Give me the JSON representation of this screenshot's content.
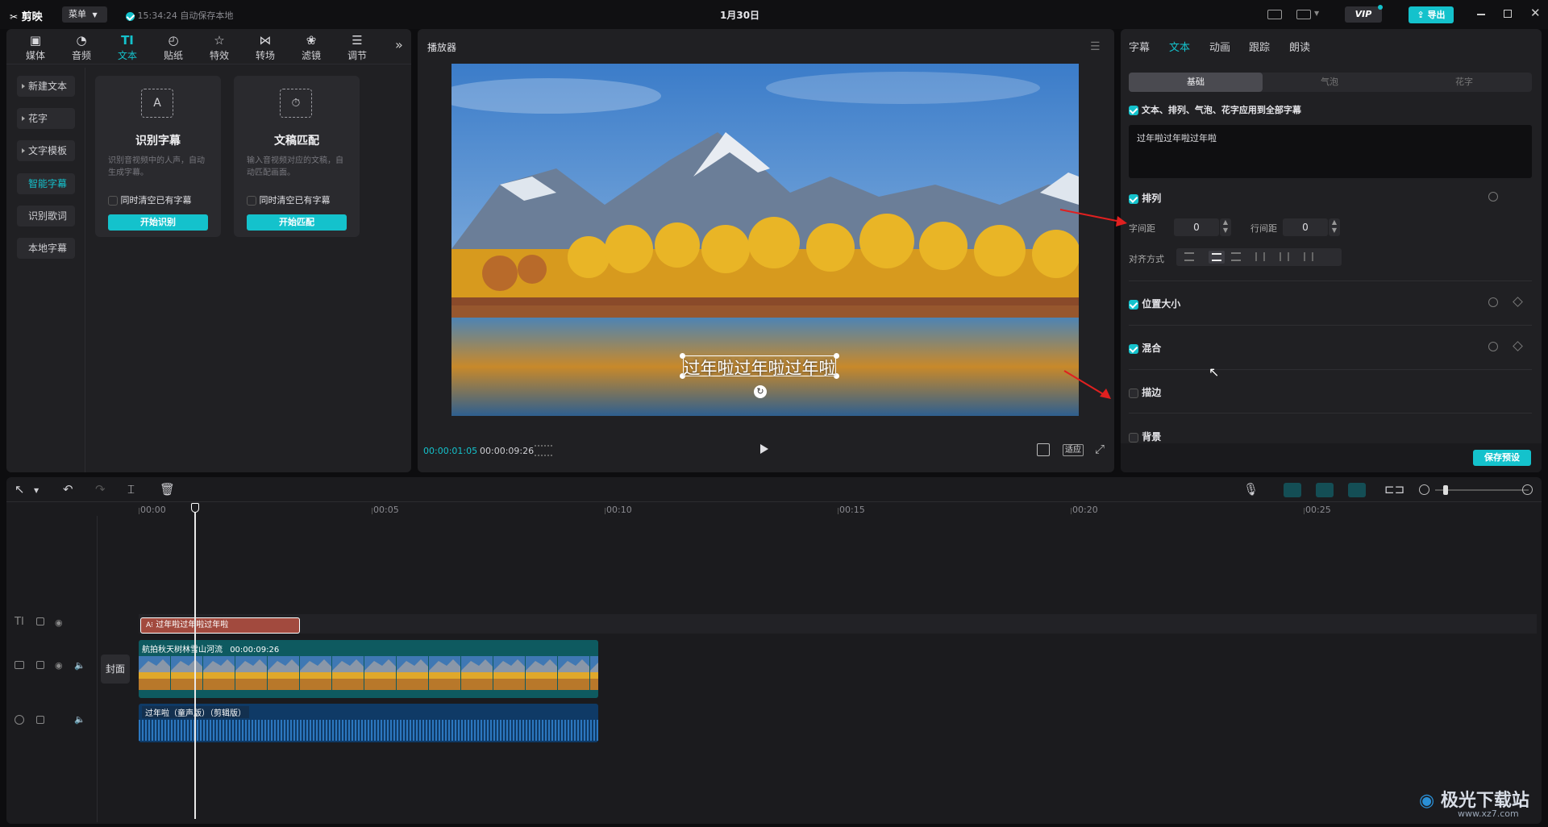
{
  "app": {
    "logo": "剪映",
    "menu_label": "菜单",
    "autosave": "15:34:24 自动保存本地",
    "project_title": "1月30日",
    "vip_label": "VIP",
    "export_label": "导出"
  },
  "toolbar_tabs": [
    {
      "label": "媒体",
      "icon": "media-icon"
    },
    {
      "label": "音频",
      "icon": "audio-icon"
    },
    {
      "label": "文本",
      "icon": "text-icon"
    },
    {
      "label": "贴纸",
      "icon": "sticker-icon"
    },
    {
      "label": "特效",
      "icon": "effects-icon"
    },
    {
      "label": "转场",
      "icon": "transition-icon"
    },
    {
      "label": "滤镜",
      "icon": "filter-icon"
    },
    {
      "label": "调节",
      "icon": "adjust-icon"
    }
  ],
  "text_sidebar": [
    "新建文本",
    "花字",
    "文字模板",
    "智能字幕",
    "识别歌词",
    "本地字幕"
  ],
  "cards": [
    {
      "title": "识别字幕",
      "desc": "识别音视频中的人声，自动生成字幕。",
      "option": "同时清空已有字幕",
      "button": "开始识别"
    },
    {
      "title": "文稿匹配",
      "desc": "输入音视频对应的文稿，自动匹配画面。",
      "option": "同时清空已有字幕",
      "button": "开始匹配"
    }
  ],
  "player": {
    "title": "播放器",
    "subtitle_text": "过年啦过年啦过年啦",
    "current_time": "00:00:01:05",
    "total_time": "00:00:09:26",
    "fit_label": "适应"
  },
  "inspector": {
    "tabs": [
      "字幕",
      "文本",
      "动画",
      "跟踪",
      "朗读"
    ],
    "active_tab": "文本",
    "subtabs": [
      "基础",
      "气泡",
      "花字"
    ],
    "apply_all": "文本、排列、气泡、花字应用到全部字幕",
    "text_value": "过年啦过年啦过年啦",
    "arrange_label": "排列",
    "char_spacing_label": "字间距",
    "char_spacing": "0",
    "line_spacing_label": "行间距",
    "line_spacing": "0",
    "align_label": "对齐方式",
    "position_label": "位置大小",
    "blend_label": "混合",
    "stroke_label": "描边",
    "background_label": "背景",
    "save_preset": "保存预设"
  },
  "timeline": {
    "ruler": [
      "00:00",
      "00:05",
      "00:10",
      "00:15",
      "00:20",
      "00:25"
    ],
    "text_clip": "过年啦过年啦过年啦",
    "video_clip_name": "航拍秋天树林雪山河流",
    "video_clip_duration": "00:00:09:26",
    "cover_label": "封面",
    "audio_clip": "过年啦（童声版）（剪辑版）"
  },
  "watermark": {
    "brand": "极光下载站",
    "url": "www.xz7.com"
  },
  "colors": {
    "accent": "#14c2cc",
    "text_clip": "#a24a3e",
    "video_track": "#0e5a60",
    "audio_track": "#0f3a66"
  }
}
